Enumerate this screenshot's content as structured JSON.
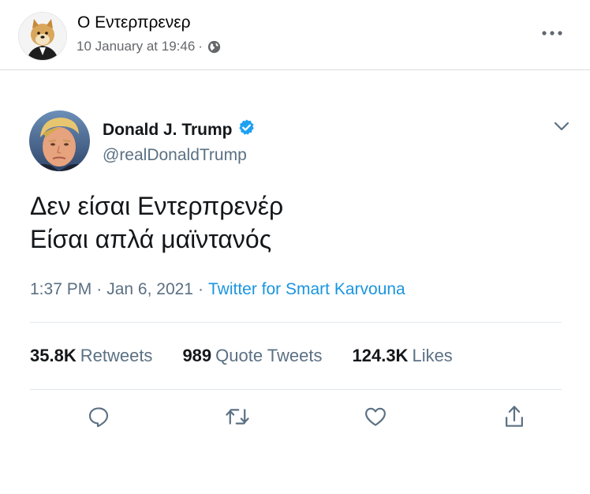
{
  "post": {
    "author": "Ο Εντερπρενερ",
    "timestamp": "10 January at 19:46",
    "dot": "·",
    "privacy_icon": "globe-icon",
    "more_icon": "more-dots-icon"
  },
  "tweet": {
    "name": "Donald J. Trump",
    "verified_icon": "verified-badge-icon",
    "handle": "@realDonaldTrump",
    "text_lines": [
      "Δεν είσαι Εντερπρενέρ",
      "Είσαι απλά μαϊντανός"
    ],
    "time": "1:37 PM",
    "date": "Jan 6, 2021",
    "separator": "·",
    "source": "Twitter for Smart Karvouna",
    "stats": {
      "retweets": {
        "count": "35.8K",
        "label": "Retweets"
      },
      "quote_tweets": {
        "count": "989",
        "label": "Quote Tweets"
      },
      "likes": {
        "count": "124.3K",
        "label": "Likes"
      }
    },
    "actions": [
      "reply-icon",
      "retweet-icon",
      "like-icon",
      "share-icon"
    ]
  },
  "colors": {
    "facebook_secondary_text": "#65676b",
    "twitter_blue": "#1b95e0",
    "twitter_secondary_text": "#5b7083",
    "twitter_primary_text": "#14171a",
    "verified_badge": "#1da1f2"
  }
}
